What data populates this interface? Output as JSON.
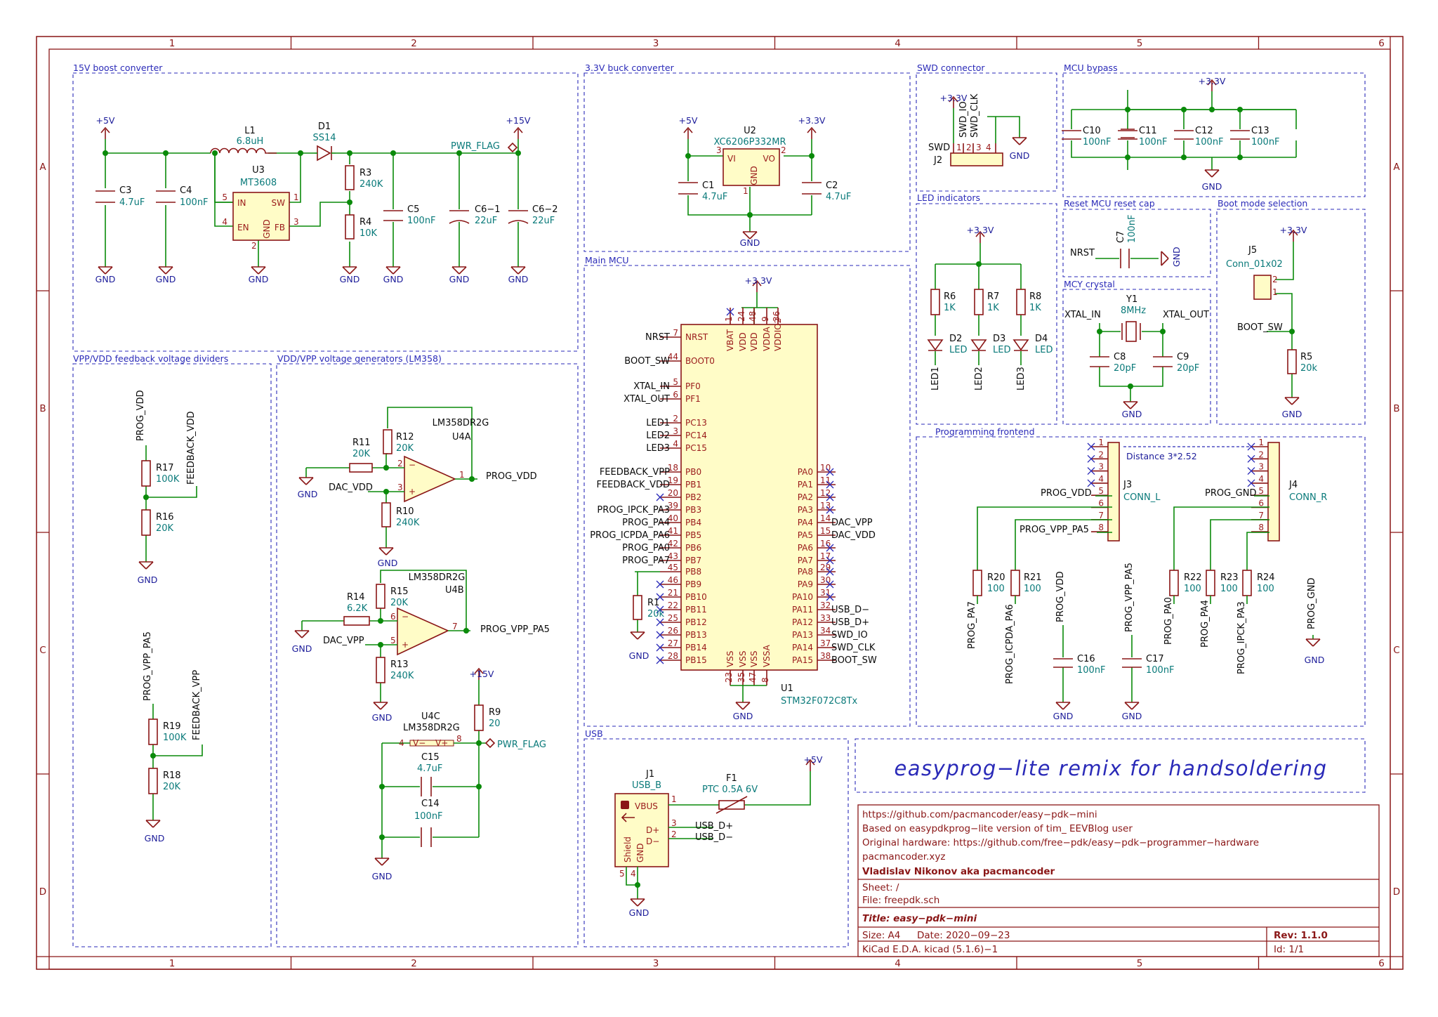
{
  "frame": {
    "cols": [
      "1",
      "2",
      "3",
      "4",
      "5",
      "6"
    ],
    "rows": [
      "A",
      "B",
      "C",
      "D"
    ]
  },
  "blocks": {
    "boost": "15V boost converter",
    "buck": "3.3V buck converter",
    "swd": "SWD connector",
    "bypass": "MCU bypass",
    "led": "LED indicators",
    "reset": "Reset MCU reset cap",
    "boot": "Boot mode selection",
    "crystal": "MCY crystal",
    "mcu": "Main MCU",
    "dividers": "VPP/VDD feedback voltage dividers",
    "generators": "VDD/VPP voltage generators (LM358)",
    "prog": "Programming frontend",
    "usb": "USB"
  },
  "banner": "easyprog−lite remix for handsoldering",
  "boost": {
    "p5v": "+5V",
    "p15v": "+15V",
    "gnd": "GND",
    "pwrflag": "PWR_FLAG",
    "c3": "C3",
    "c3v": "4.7uF",
    "c4": "C4",
    "c4v": "100nF",
    "l1": "L1",
    "l1v": "6.8uH",
    "d1": "D1",
    "d1v": "SS14",
    "u3": "U3",
    "u3v": "MT3608",
    "in": "IN",
    "en": "EN",
    "sw": "SW",
    "fb": "FB",
    "gndpin": "GND",
    "n5": "5",
    "n4": "4",
    "n1": "1",
    "n3": "3",
    "n2": "2",
    "r3": "R3",
    "r3v": "240K",
    "r4": "R4",
    "r4v": "10K",
    "c5": "C5",
    "c5v": "100nF",
    "c61": "C6−1",
    "c61v": "22uF",
    "c62": "C6−2",
    "c62v": "22uF"
  },
  "buck": {
    "p5v": "+5V",
    "p33": "+3.3V",
    "gnd": "GND",
    "u2": "U2",
    "u2v": "XC6206P332MR",
    "vi": "VI",
    "vo": "VO",
    "gndpin": "GND",
    "n3": "3",
    "n2": "2",
    "n1": "1",
    "c1": "C1",
    "c1v": "4.7uF",
    "c2": "C2",
    "c2v": "4.7uF"
  },
  "swd": {
    "p33": "+3.3V",
    "io": "SWD_IO",
    "clk": "SWD_CLK",
    "gnd": "GND",
    "swd": "SWD",
    "j2": "J2",
    "n1": "1",
    "n2": "2",
    "n3": "3",
    "n4": "4"
  },
  "bypass": {
    "p33": "+3.3V",
    "gnd": "GND",
    "c10": "C10",
    "c11": "C11",
    "c12": "C12",
    "c13": "C13",
    "val": "100nF"
  },
  "led": {
    "p33": "+3.3V",
    "r6": "R6",
    "r7": "R7",
    "r8": "R8",
    "rv": "1K",
    "d2": "D2",
    "d3": "D3",
    "d4": "D4",
    "led": "LED",
    "led1": "LED1",
    "led2": "LED2",
    "led3": "LED3"
  },
  "reset": {
    "nrst": "NRST",
    "c7": "C7",
    "c7v": "100nF",
    "gnd": "GND"
  },
  "boot": {
    "p33": "+3.3V",
    "j5": "J5",
    "j5v": "Conn_01x02",
    "bootsw": "BOOT_SW",
    "r5": "R5",
    "r5v": "20k",
    "gnd": "GND",
    "n1": "1",
    "n2": "2"
  },
  "crystal": {
    "xin": "XTAL_IN",
    "xout": "XTAL_OUT",
    "y1": "Y1",
    "y1v": "8MHz",
    "c8": "C8",
    "c8v": "20pF",
    "c9": "C9",
    "c9v": "20pF",
    "gnd": "GND"
  },
  "mcu": {
    "p33": "+3.3V",
    "u1": "U1",
    "u1v": "STM32F072C8Tx",
    "gnd": "GND",
    "r1": "R1",
    "r1v": "20k",
    "top_pins": [
      {
        "name": "VBAT",
        "num": "1"
      },
      {
        "name": "VDD",
        "num": "24"
      },
      {
        "name": "VDD",
        "num": "48"
      },
      {
        "name": "VDDA",
        "num": "9"
      },
      {
        "name": "VDDIO2",
        "num": "36"
      }
    ],
    "bottom_pins": [
      {
        "name": "VSS",
        "num": "23"
      },
      {
        "name": "VSS",
        "num": "35"
      },
      {
        "name": "VSS",
        "num": "47"
      },
      {
        "name": "VSSA",
        "num": "8"
      }
    ],
    "left_pins": [
      {
        "pin": "NRST",
        "num": "7",
        "net": "NRST"
      },
      {
        "pin": "BOOT0",
        "num": "44",
        "net": "BOOT_SW"
      },
      {
        "pin": "PF0",
        "num": "5",
        "net": "XTAL_IN"
      },
      {
        "pin": "PF1",
        "num": "6",
        "net": "XTAL_OUT"
      },
      {
        "pin": "PC13",
        "num": "2",
        "net": "LED1"
      },
      {
        "pin": "PC14",
        "num": "3",
        "net": "LED2"
      },
      {
        "pin": "PC15",
        "num": "4",
        "net": "LED3"
      },
      {
        "pin": "PB0",
        "num": "18",
        "net": "FEEDBACK_VPP"
      },
      {
        "pin": "PB1",
        "num": "19",
        "net": "FEEDBACK_VDD"
      },
      {
        "pin": "PB2",
        "num": "20",
        "net": ""
      },
      {
        "pin": "PB3",
        "num": "39",
        "net": "PROG_IPCK_PA3"
      },
      {
        "pin": "PB4",
        "num": "40",
        "net": "PROG_PA4"
      },
      {
        "pin": "PB5",
        "num": "41",
        "net": "PROG_ICPDA_PA6"
      },
      {
        "pin": "PB6",
        "num": "42",
        "net": "PROG_PA0"
      },
      {
        "pin": "PB7",
        "num": "43",
        "net": "PROG_PA7"
      },
      {
        "pin": "PB8",
        "num": "45",
        "net": ""
      },
      {
        "pin": "PB9",
        "num": "46",
        "net": ""
      },
      {
        "pin": "PB10",
        "num": "21",
        "net": ""
      },
      {
        "pin": "PB11",
        "num": "22",
        "net": ""
      },
      {
        "pin": "PB12",
        "num": "25",
        "net": ""
      },
      {
        "pin": "PB13",
        "num": "26",
        "net": ""
      },
      {
        "pin": "PB14",
        "num": "27",
        "net": ""
      },
      {
        "pin": "PB15",
        "num": "28",
        "net": ""
      }
    ],
    "right_pins": [
      {
        "pin": "PA0",
        "num": "10",
        "net": ""
      },
      {
        "pin": "PA1",
        "num": "11",
        "net": ""
      },
      {
        "pin": "PA2",
        "num": "12",
        "net": ""
      },
      {
        "pin": "PA3",
        "num": "13",
        "net": ""
      },
      {
        "pin": "PA4",
        "num": "14",
        "net": "DAC_VPP"
      },
      {
        "pin": "PA5",
        "num": "15",
        "net": "DAC_VDD"
      },
      {
        "pin": "PA6",
        "num": "16",
        "net": ""
      },
      {
        "pin": "PA7",
        "num": "17",
        "net": ""
      },
      {
        "pin": "PA8",
        "num": "29",
        "net": ""
      },
      {
        "pin": "PA9",
        "num": "30",
        "net": ""
      },
      {
        "pin": "PA10",
        "num": "31",
        "net": ""
      },
      {
        "pin": "PA11",
        "num": "32",
        "net": "USB_D−"
      },
      {
        "pin": "PA12",
        "num": "33",
        "net": "USB_D+"
      },
      {
        "pin": "PA13",
        "num": "34",
        "net": "SWD_IO"
      },
      {
        "pin": "PA14",
        "num": "37",
        "net": "SWD_CLK"
      },
      {
        "pin": "PA15",
        "num": "38",
        "net": "BOOT_SW"
      }
    ]
  },
  "dividers": {
    "progvdd": "PROG_VDD",
    "fbvdd": "FEEDBACK_VDD",
    "r17": "R17",
    "r17v": "100K",
    "r16": "R16",
    "r16v": "20K",
    "progvpp": "PROG_VPP_PA5",
    "fbvpp": "FEEDBACK_VPP",
    "r19": "R19",
    "r19v": "100K",
    "r18": "R18",
    "r18v": "20K",
    "gnd": "GND"
  },
  "gen": {
    "u4a": "U4A",
    "u4av": "LM358DR2G",
    "r11": "R11",
    "r11v": "20K",
    "r12": "R12",
    "r12v": "20K",
    "r10": "R10",
    "r10v": "240K",
    "dacvdd": "DAC_VDD",
    "progvdd": "PROG_VDD",
    "u4b": "U4B",
    "u4bv": "LM358DR2G",
    "r14": "R14",
    "r14v": "6.2K",
    "r15": "R15",
    "r15v": "20K",
    "r13": "R13",
    "r13v": "240K",
    "dacvpp": "DAC_VPP",
    "progvpp": "PROG_VPP_PA5",
    "u4c": "U4C",
    "u4cv": "LM358DR2G",
    "vm": "V−",
    "vp": "V+",
    "n4": "4",
    "n8": "8",
    "r9": "R9",
    "r9v": "20",
    "p15v": "+15V",
    "pwrflag": "PWR_FLAG",
    "c15": "C15",
    "c15v": "4.7uF",
    "c14": "C14",
    "c14v": "100nF",
    "gnd": "GND",
    "pa": [
      "2",
      "3",
      "1"
    ],
    "pb": [
      "6",
      "5",
      "7"
    ]
  },
  "prog": {
    "dist": "Distance 3*2.52",
    "j3": "J3",
    "j3v": "CONN_L",
    "j4": "J4",
    "j4v": "CONN_R",
    "progvdd": "PROG_VDD",
    "progvpp": "PROG_VPP_PA5",
    "proggnd": "PROG_GND",
    "pins": [
      "1",
      "2",
      "3",
      "4",
      "5",
      "6",
      "7",
      "8"
    ],
    "r20": "R20",
    "r21": "R21",
    "r22": "R22",
    "r23": "R23",
    "r24": "R24",
    "rv": "100",
    "c16": "C16",
    "c17": "C17",
    "cv": "100nF",
    "n_pa7": "PROG_PA7",
    "n_icpda": "PROG_ICPDA_PA6",
    "n_vdd": "PROG_VDD",
    "n_vpp": "PROG_VPP_PA5",
    "n_pa0": "PROG_PA0",
    "n_pa4": "PROG_PA4",
    "n_ipck": "PROG_IPCK_PA3",
    "n_gnd": "PROG_GND",
    "gnd": "GND"
  },
  "usb": {
    "j1": "J1",
    "j1v": "USB_B",
    "vbus": "VBUS",
    "dp": "D+",
    "dm": "D−",
    "shield": "Shield",
    "gndpin": "GND",
    "f1": "F1",
    "f1v": "PTC 0.5A 6V",
    "p5v": "+5V",
    "usbdp": "USB_D+",
    "usbdm": "USB_D−",
    "gnd": "GND",
    "n1": "1",
    "n2": "2",
    "n3": "3",
    "n4": "4",
    "n5": "5"
  },
  "titleblock": {
    "url": "https://github.com/pacmancoder/easy−pdk−mini",
    "based": "Based on easypdkprog−lite version of tim_ EEVBlog user",
    "orig": "Original hardware: https://github.com/free−pdk/easy−pdk−programmer−hardware",
    "site": "pacmancoder.xyz",
    "author": "Vladislav Nikonov aka pacmancoder",
    "sheet": "Sheet: /",
    "file": "File: freepdk.sch",
    "title": "Title: easy−pdk−mini",
    "size": "Size: A4",
    "date": "Date: 2020−09−23",
    "rev": "Rev: 1.1.0",
    "tool": "KiCad E.D.A.  kicad (5.1.6)−1",
    "id": "Id: 1/1"
  }
}
